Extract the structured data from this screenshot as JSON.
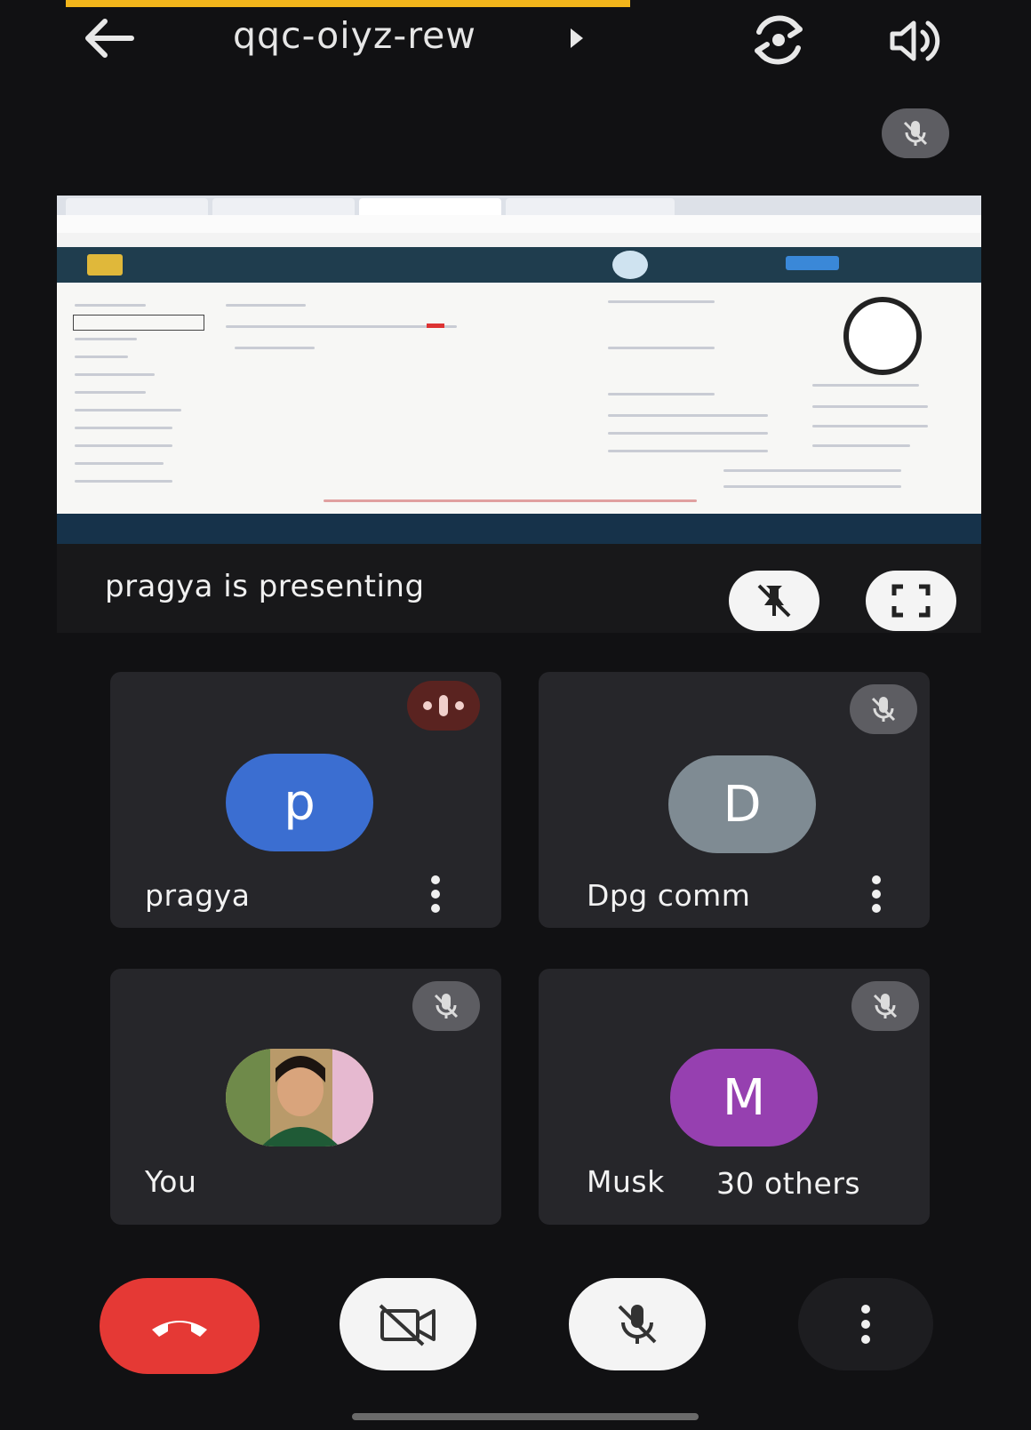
{
  "header": {
    "meeting_code": "qqc-oiyz-rew",
    "back_icon": "arrow-left-icon",
    "switch_camera_icon": "switch-camera-icon",
    "speaker_icon": "speaker-icon"
  },
  "presentation": {
    "presenter_label": "pragya is presenting",
    "unpin_icon": "pin-off-icon",
    "fullscreen_icon": "fullscreen-icon"
  },
  "participants": [
    {
      "name": "pragya",
      "initial": "p",
      "avatar_color": "#3b6ed1",
      "status": "speaking"
    },
    {
      "name": "Dpg comm",
      "initial": "D",
      "avatar_color": "#7f8b93",
      "status": "muted"
    },
    {
      "name": "You",
      "initial": "",
      "avatar_color": "#7a8a6a",
      "status": "muted"
    },
    {
      "name": "Musk",
      "initial": "M",
      "avatar_color": "#9640b0",
      "status": "muted",
      "others_label": "30 others"
    }
  ],
  "controls": {
    "end_call_icon": "end-call-icon",
    "camera_off_icon": "camera-off-icon",
    "mic_off_icon": "mic-off-icon",
    "more_icon": "more-vertical-icon"
  },
  "colors": {
    "background": "#111113",
    "tile": "#26262a",
    "end_call": "#e53935",
    "accent_strip": "#f2b51b"
  }
}
